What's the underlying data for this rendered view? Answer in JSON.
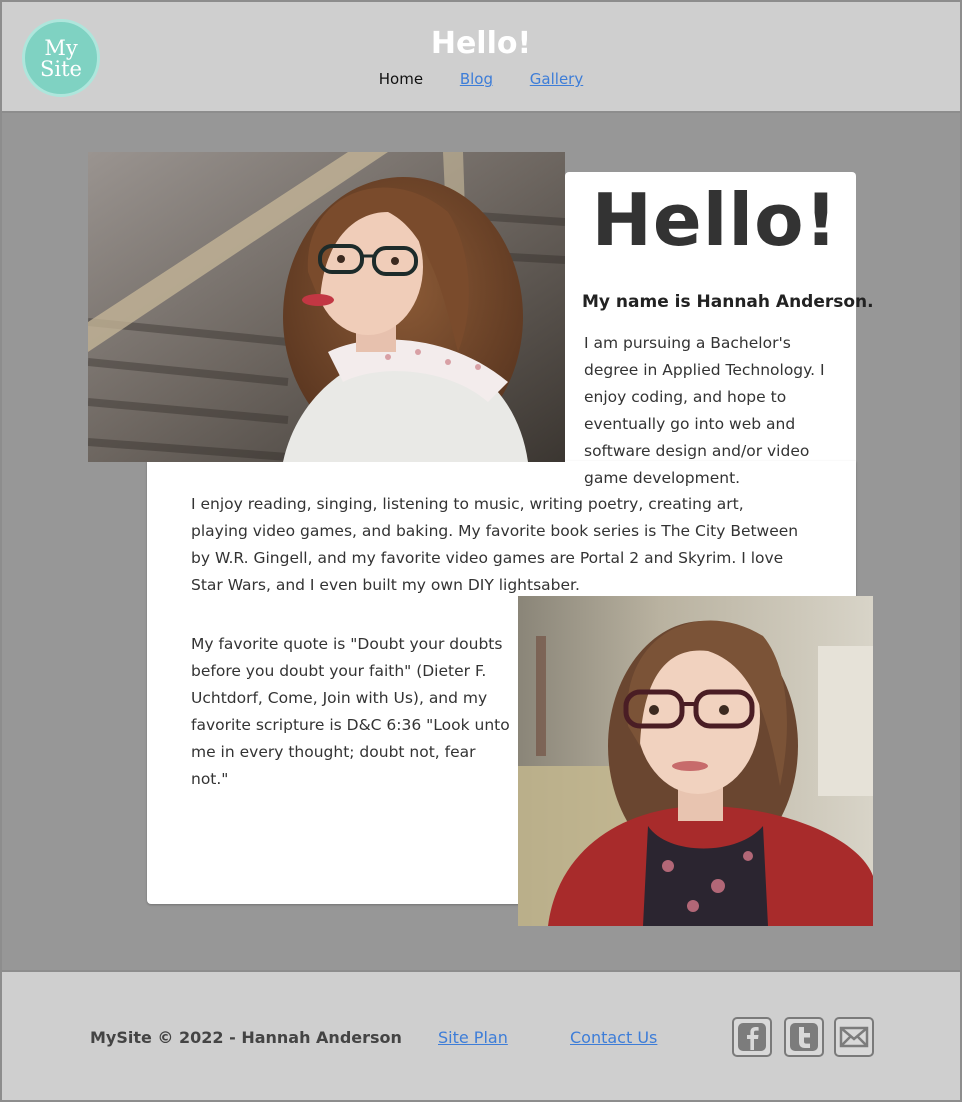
{
  "header": {
    "logo_line1": "My",
    "logo_line2": "Site",
    "title": "Hello!",
    "nav": [
      {
        "label": "Home",
        "active": true
      },
      {
        "label": "Blog",
        "active": false
      },
      {
        "label": "Gallery",
        "active": false
      }
    ]
  },
  "main": {
    "heading": "Hello!",
    "name_line": "My name is Hannah Anderson.",
    "intro": "I am pursuing a Bachelor's degree in Applied Technology. I enjoy coding, and hope to eventually go into web and software design and/or video game development.",
    "paragraph1": "I enjoy reading, singing, listening to music, writing poetry, creating art, playing video games, and baking. My favorite book series is The City Between by W.R. Gingell, and my favorite video games are Portal 2 and Skyrim. I love Star Wars, and I even built my own DIY lightsaber.",
    "paragraph2": "My favorite quote is \"Doubt your doubts before you doubt your faith\" (Dieter F. Uchtdorf, Come, Join with Us), and my favorite scripture is D&C 6:36 \"Look unto me in every thought; doubt not, fear not.\""
  },
  "footer": {
    "copyright": "MySite © 2022 - Hannah Anderson",
    "site_plan": "Site Plan",
    "contact": "Contact Us",
    "social_icons": [
      "facebook-icon",
      "twitter-icon",
      "email-icon"
    ]
  },
  "colors": {
    "header_bg": "#cfcfcf",
    "main_bg": "#979797",
    "logo_teal": "#7fd2c2",
    "link_blue": "#3d7dd8"
  }
}
